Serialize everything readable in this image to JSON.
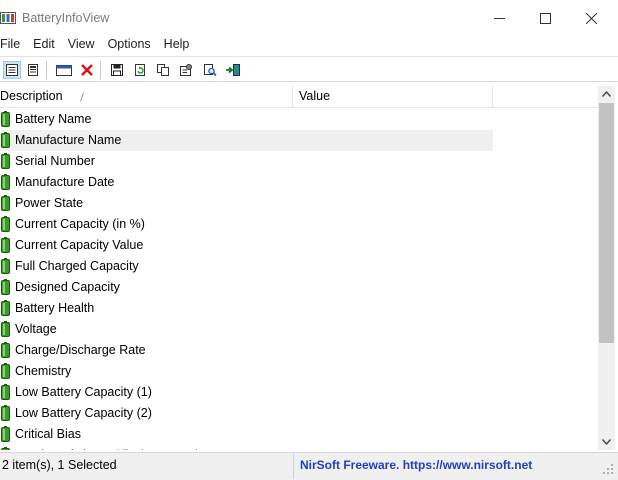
{
  "window": {
    "title": "BatteryInfoView",
    "minimize_glyph": "—",
    "maximize_glyph": "☐",
    "close_glyph": "✕"
  },
  "menu": [
    "File",
    "Edit",
    "View",
    "Options",
    "Help"
  ],
  "toolbar": {
    "icons": [
      "html-report-icon",
      "properties-list-icon",
      "log-window-icon",
      "delete-icon",
      "save-icon",
      "refresh-icon",
      "copy-icon",
      "properties-icon",
      "find-icon",
      "exit-icon"
    ]
  },
  "list": {
    "columns": [
      "Description",
      "Value"
    ],
    "rows": [
      {
        "label": "Battery Name",
        "selected": false
      },
      {
        "label": "Manufacture Name",
        "selected": true
      },
      {
        "label": "Serial Number",
        "selected": false
      },
      {
        "label": "Manufacture Date",
        "selected": false
      },
      {
        "label": "Power State",
        "selected": false
      },
      {
        "label": "Current Capacity (in %)",
        "selected": false
      },
      {
        "label": "Current Capacity Value",
        "selected": false
      },
      {
        "label": "Full Charged Capacity",
        "selected": false
      },
      {
        "label": "Designed Capacity",
        "selected": false
      },
      {
        "label": "Battery Health",
        "selected": false
      },
      {
        "label": "Voltage",
        "selected": false
      },
      {
        "label": "Charge/Discharge Rate",
        "selected": false
      },
      {
        "label": "Chemistry",
        "selected": false
      },
      {
        "label": "Low Battery Capacity (1)",
        "selected": false
      },
      {
        "label": "Low Battery Capacity (2)",
        "selected": false
      },
      {
        "label": "Critical Bias",
        "selected": false
      },
      {
        "label": "Number of charge/discharge cycles",
        "selected": false
      }
    ]
  },
  "scrollbar": {
    "up_glyph": "⌃",
    "down_glyph": "⌄"
  },
  "status": {
    "selection": "2 item(s), 1 Selected",
    "credit": "NirSoft Freeware. https://www.nirsoft.net"
  },
  "colors": {
    "battery_green": "#3a9b2a",
    "selected_row": "#f0f0f0",
    "link_blue": "#1f3fbf"
  }
}
